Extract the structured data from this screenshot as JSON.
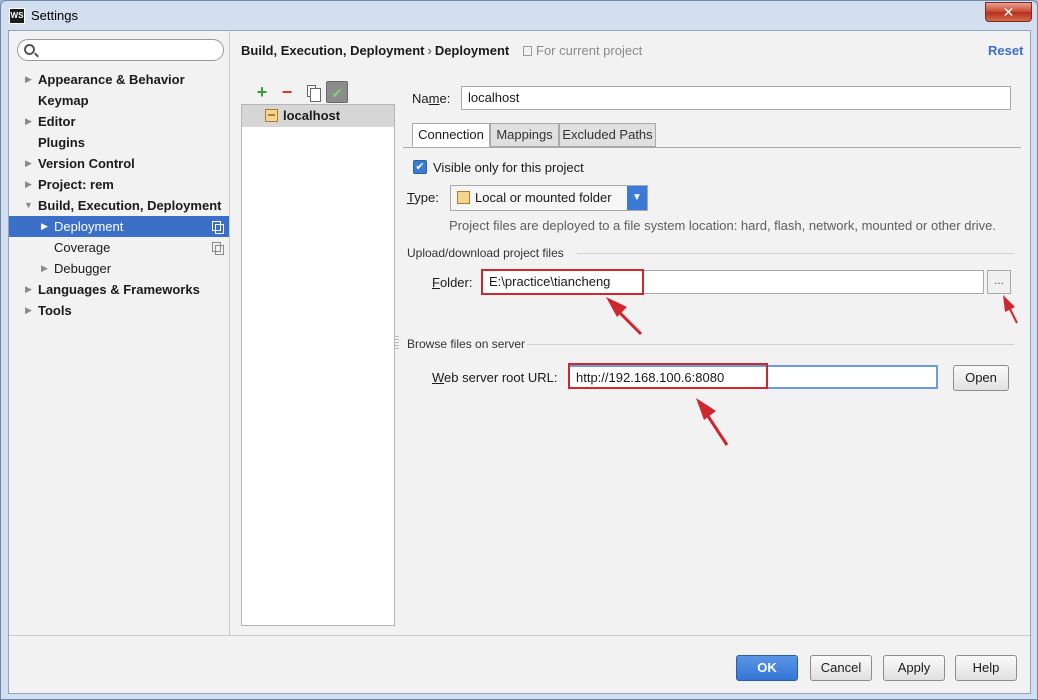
{
  "window": {
    "title": "Settings",
    "app_icon_text": "WS",
    "close_glyph": "✕"
  },
  "search": {
    "placeholder": "",
    "value": ""
  },
  "sidebar": {
    "items": [
      {
        "label": "Appearance & Behavior",
        "expandable": true
      },
      {
        "label": "Keymap",
        "expandable": false
      },
      {
        "label": "Editor",
        "expandable": true
      },
      {
        "label": "Plugins",
        "expandable": false
      },
      {
        "label": "Version Control",
        "expandable": true
      },
      {
        "label": "Project: rem",
        "expandable": true
      },
      {
        "label": "Build, Execution, Deployment",
        "expanded": true
      },
      {
        "label": "Deployment",
        "selected": true,
        "child": true
      },
      {
        "label": "Coverage",
        "child": true
      },
      {
        "label": "Debugger",
        "child": true,
        "expandable": true
      },
      {
        "label": "Languages & Frameworks",
        "expandable": true
      },
      {
        "label": "Tools",
        "expandable": true
      }
    ]
  },
  "header": {
    "breadcrumb_parent": "Build, Execution, Deployment",
    "breadcrumb_sep": "›",
    "breadcrumb_current": "Deployment",
    "scope": "For current project",
    "reset": "Reset"
  },
  "servers": {
    "toolbar": {
      "add": "+",
      "remove": "−",
      "default_mark": "✔"
    },
    "items": [
      {
        "label": "localhost",
        "selected": true
      }
    ]
  },
  "form": {
    "name_label_pre": "Na",
    "name_label_u": "m",
    "name_label_post": "e:",
    "name_value": "localhost",
    "tabs": [
      {
        "label": "Connection",
        "active": true
      },
      {
        "label": "Mappings",
        "active": false
      },
      {
        "label": "Excluded Paths",
        "active": false
      }
    ],
    "visible_only_label": "Visible only for this project",
    "visible_only_checked": true,
    "type_label_u": "T",
    "type_label_post": "ype:",
    "type_value": "Local or mounted folder",
    "type_hint": "Project files are deployed to a file system location: hard, flash, network, mounted or other drive.",
    "upload_section": "Upload/download project files",
    "folder_label_u": "F",
    "folder_label_post": "older:",
    "folder_value": "E:\\practice\\tiancheng",
    "browse_label": "...",
    "browse_section": "Browse files on server",
    "url_label_u": "W",
    "url_label_post": "eb server root URL:",
    "url_value": "http://192.168.100.6:8080",
    "open_label": "Open"
  },
  "footer": {
    "ok": "OK",
    "cancel": "Cancel",
    "apply": "Apply",
    "help": "Help"
  },
  "colors": {
    "accent": "#3b6fc8",
    "annotation_red": "#d0262d",
    "ok_button": "#3576d6"
  }
}
